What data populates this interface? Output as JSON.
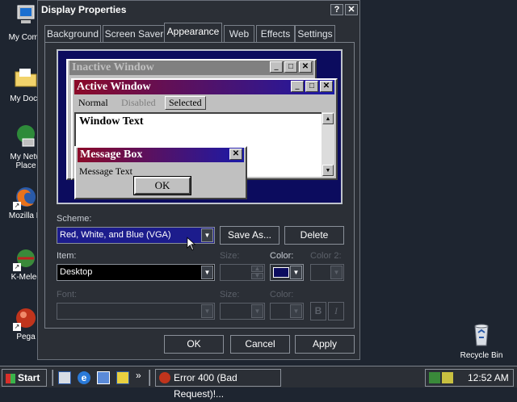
{
  "desktop": {
    "icons": [
      {
        "label": "My Comp",
        "icon": "computer-icon"
      },
      {
        "label": "My Docu",
        "icon": "folder-icon"
      },
      {
        "label": "My Netw Place",
        "icon": "network-icon"
      },
      {
        "label": "Mozilla Fi",
        "icon": "firefox-icon"
      },
      {
        "label": "K-Melec",
        "icon": "k-meleon-icon"
      },
      {
        "label": "Pega",
        "icon": "pegasus-icon"
      }
    ],
    "recycle_bin": {
      "label": "Recycle Bin",
      "icon": "recycle-bin-icon"
    }
  },
  "dialog": {
    "title": "Display Properties",
    "help_button": "?",
    "close_button": "✕",
    "tabs": [
      "Background",
      "Screen Saver",
      "Appearance",
      "Web",
      "Effects",
      "Settings"
    ],
    "active_tab": "Appearance",
    "preview": {
      "inactive_window_title": "Inactive Window",
      "active_window_title": "Active Window",
      "menu_normal": "Normal",
      "menu_disabled": "Disabled",
      "menu_selected": "Selected",
      "window_text": "Window Text",
      "message_box_title": "Message Box",
      "message_text": "Message Text",
      "ok_label": "OK"
    },
    "scheme_label": "Scheme:",
    "scheme_value": "Red, White, and Blue (VGA)",
    "save_as_label": "Save As...",
    "delete_label": "Delete",
    "item_label": "Item:",
    "item_value": "Desktop",
    "size_label": "Size:",
    "color_label": "Color:",
    "color2_label": "Color 2:",
    "font_label": "Font:",
    "font_size_label": "Size:",
    "font_color_label": "Color:",
    "bold_label": "B",
    "italic_label": "I",
    "ok_label": "OK",
    "cancel_label": "Cancel",
    "apply_label": "Apply",
    "item_color": "#0c0c5e"
  },
  "taskbar": {
    "start_label": "Start",
    "quick_launch": [
      "desktop-icon",
      "ie-icon",
      "outlook-icon",
      "channels-icon"
    ],
    "chevron": "»",
    "task_label": "Error 400 (Bad Request)!...",
    "clock": "12:52 AM"
  },
  "colors": {
    "active_caption": "#8b0a28",
    "active_caption_end": "#1a1aa8",
    "preview_desktop": "#0c0c5e",
    "scheme_selected_bg": "#1c1c8c"
  }
}
